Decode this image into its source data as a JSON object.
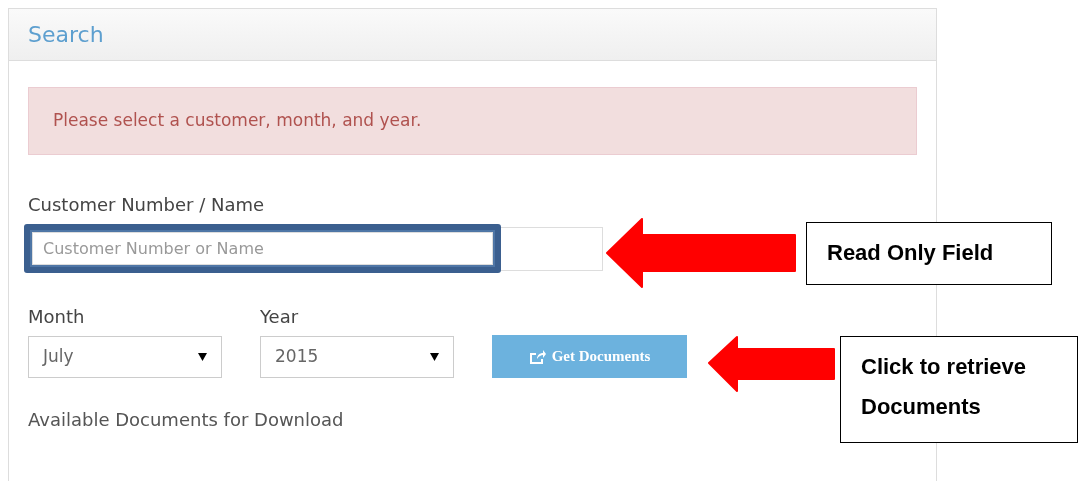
{
  "panel": {
    "title": "Search"
  },
  "alert": {
    "text": "Please select a customer, month, and year."
  },
  "customer_field": {
    "label": "Customer Number / Name",
    "placeholder": "Customer Number or Name",
    "highlighted": true
  },
  "month_field": {
    "label": "Month",
    "value": "July"
  },
  "year_field": {
    "label": "Year",
    "value": "2015"
  },
  "get_button": {
    "label": "Get Documents"
  },
  "section_label": "Available Documents for Download",
  "annotations": [
    {
      "kind": "field",
      "text": "Read Only Field"
    },
    {
      "kind": "button",
      "text": "Click to retrieve Documents"
    }
  ]
}
